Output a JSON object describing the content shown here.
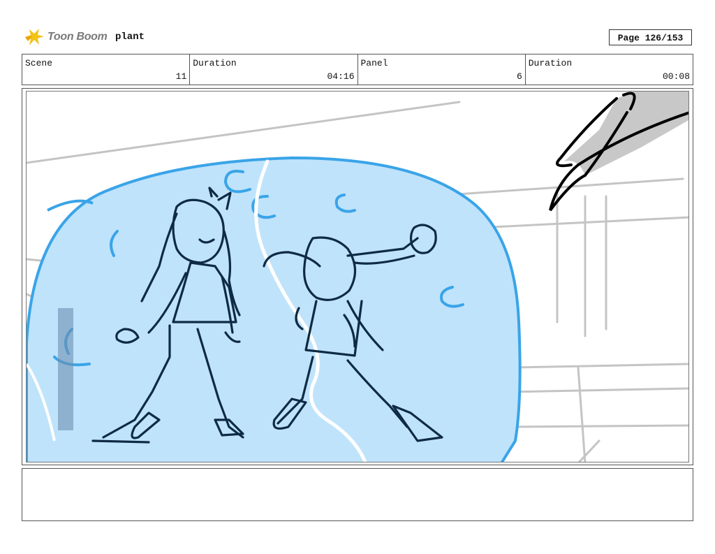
{
  "header": {
    "logo_text": "Toon Boom",
    "project_name": "plant",
    "page_label": "Page 126/153"
  },
  "info": {
    "scene_label": "Scene",
    "scene_value": "11",
    "scene_duration_label": "Duration",
    "scene_duration_value": "04:16",
    "panel_label": "Panel",
    "panel_value": "6",
    "panel_duration_label": "Duration",
    "panel_duration_value": "00:08"
  },
  "panel_image": {
    "icon": "storyboard-sketch",
    "colors": {
      "bubble": "#bfe3fb",
      "bubble_outline": "#3aa4e8",
      "ink": "#0f2a44",
      "bg_lines": "#bdbdbd",
      "spike": "#c8c8c8"
    }
  },
  "notes": {
    "text": ""
  }
}
